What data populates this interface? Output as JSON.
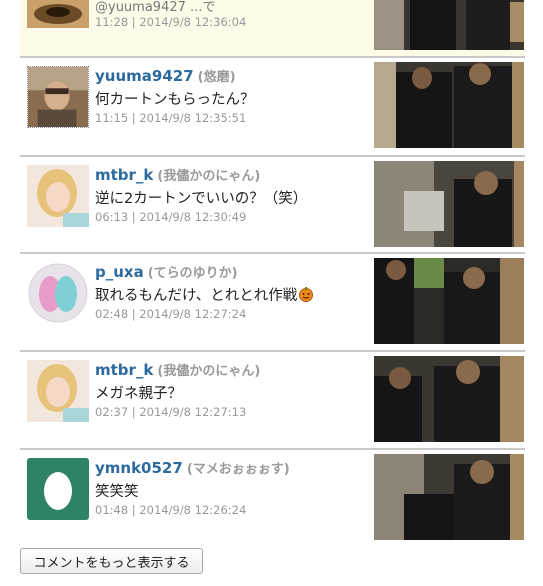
{
  "comments": [
    {
      "username": "",
      "nickname": "",
      "message": "@yuuma9427 ...で",
      "meta": "11:28 | 2014/9/8 12:36:04",
      "highlight": true,
      "avatar": "landscape-photo-avatar",
      "thumb": "video-thumbnail-icon"
    },
    {
      "username": "yuuma9427",
      "nickname": "(悠磨)",
      "message": "何カートンもらったん？",
      "meta": "11:15 | 2014/9/8 12:35:51",
      "highlight": false,
      "avatar": "user-photo-avatar",
      "thumb": "video-thumbnail-icon"
    },
    {
      "username": "mtbr_k",
      "nickname": "(我儘かのにゃん)",
      "message": "逆に2カートンでいいの？（笑）",
      "meta": "06:13 | 2014/9/8 12:30:49",
      "highlight": false,
      "avatar": "user-photo-avatar",
      "thumb": "video-thumbnail-icon"
    },
    {
      "username": "p_uxa",
      "nickname": "(てらのゆりか)",
      "message": "取れるもんだけ、とれとれ作戦",
      "meta": "02:48 | 2014/9/8 12:27:24",
      "highlight": false,
      "avatar": "round-illustration-avatar",
      "thumb": "video-thumbnail-icon",
      "emoji": "pumpkin-emoji-icon"
    },
    {
      "username": "mtbr_k",
      "nickname": "(我儘かのにゃん)",
      "message": "メガネ親子？",
      "meta": "02:37 | 2014/9/8 12:27:13",
      "highlight": false,
      "avatar": "user-photo-avatar",
      "thumb": "video-thumbnail-icon"
    },
    {
      "username": "ymnk0527",
      "nickname": "(マメおぉぉぉす)",
      "message": "笑笑笑",
      "meta": "01:48 | 2014/9/8 12:26:24",
      "highlight": false,
      "avatar": "default-egg-avatar",
      "thumb": "video-thumbnail-icon"
    }
  ],
  "more_button": {
    "label": "コメントをもっと表示する"
  },
  "colors": {
    "username": "#2d6b9e",
    "nickname": "#9a9a9a",
    "meta": "#999999",
    "highlight_bg": "#fffbe9",
    "egg_avatar_bg": "#2e8266"
  }
}
